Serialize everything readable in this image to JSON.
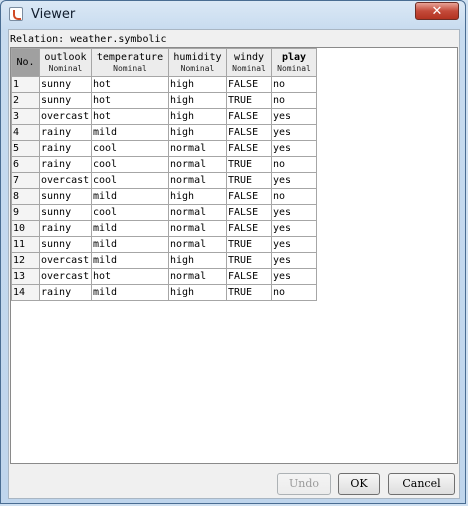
{
  "window": {
    "title": "Viewer",
    "close_glyph": "✕"
  },
  "relation_label": "Relation: weather.symbolic",
  "table": {
    "columns": [
      {
        "name": "No.",
        "type": ""
      },
      {
        "name": "outlook",
        "type": "Nominal"
      },
      {
        "name": "temperature",
        "type": "Nominal"
      },
      {
        "name": "humidity",
        "type": "Nominal"
      },
      {
        "name": "windy",
        "type": "Nominal"
      },
      {
        "name": "play",
        "type": "Nominal"
      }
    ],
    "rows": [
      [
        "1",
        "sunny",
        "hot",
        "high",
        "FALSE",
        "no"
      ],
      [
        "2",
        "sunny",
        "hot",
        "high",
        "TRUE",
        "no"
      ],
      [
        "3",
        "overcast",
        "hot",
        "high",
        "FALSE",
        "yes"
      ],
      [
        "4",
        "rainy",
        "mild",
        "high",
        "FALSE",
        "yes"
      ],
      [
        "5",
        "rainy",
        "cool",
        "normal",
        "FALSE",
        "yes"
      ],
      [
        "6",
        "rainy",
        "cool",
        "normal",
        "TRUE",
        "no"
      ],
      [
        "7",
        "overcast",
        "cool",
        "normal",
        "TRUE",
        "yes"
      ],
      [
        "8",
        "sunny",
        "mild",
        "high",
        "FALSE",
        "no"
      ],
      [
        "9",
        "sunny",
        "cool",
        "normal",
        "FALSE",
        "yes"
      ],
      [
        "10",
        "rainy",
        "mild",
        "normal",
        "FALSE",
        "yes"
      ],
      [
        "11",
        "sunny",
        "mild",
        "normal",
        "TRUE",
        "yes"
      ],
      [
        "12",
        "overcast",
        "mild",
        "high",
        "TRUE",
        "yes"
      ],
      [
        "13",
        "overcast",
        "hot",
        "normal",
        "FALSE",
        "yes"
      ],
      [
        "14",
        "rainy",
        "mild",
        "high",
        "TRUE",
        "no"
      ]
    ]
  },
  "buttons": {
    "undo": "Undo",
    "ok": "OK",
    "cancel": "Cancel"
  }
}
